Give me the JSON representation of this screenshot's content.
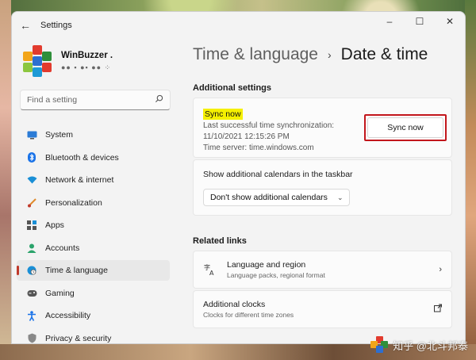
{
  "window": {
    "title": "Settings",
    "controls": {
      "minimize": "–",
      "maximize": "☐",
      "close": "✕"
    }
  },
  "profile": {
    "name": "WinBuzzer .",
    "sub": "●● ▪ ●▪ ●● ⁘"
  },
  "search": {
    "placeholder": "Find a setting",
    "icon": "search-icon"
  },
  "nav": {
    "items": [
      {
        "label": "System",
        "icon": "monitor-icon",
        "color": "#2b7bd6"
      },
      {
        "label": "Bluetooth & devices",
        "icon": "bluetooth-icon",
        "color": "#1a73e8"
      },
      {
        "label": "Network & internet",
        "icon": "wifi-icon",
        "color": "#1a8fd6"
      },
      {
        "label": "Personalization",
        "icon": "brush-icon",
        "color": "#e08a2b"
      },
      {
        "label": "Apps",
        "icon": "apps-icon",
        "color": "#555"
      },
      {
        "label": "Accounts",
        "icon": "person-icon",
        "color": "#2aa36b"
      },
      {
        "label": "Time & language",
        "icon": "globe-clock-icon",
        "color": "#1a8fd6",
        "active": true
      },
      {
        "label": "Gaming",
        "icon": "gamepad-icon",
        "color": "#555"
      },
      {
        "label": "Accessibility",
        "icon": "accessibility-icon",
        "color": "#1a73e8"
      },
      {
        "label": "Privacy & security",
        "icon": "shield-icon",
        "color": "#888"
      }
    ]
  },
  "main": {
    "breadcrumb": {
      "parent": "Time & language",
      "separator": "›",
      "current": "Date & time"
    },
    "additional_settings": {
      "title": "Additional settings",
      "sync": {
        "title": "Sync now",
        "last_sync_label": "Last successful time synchronization:",
        "last_sync_time": "11/10/2021 12:15:26 PM",
        "time_server": "Time server: time.windows.com",
        "button": "Sync now"
      },
      "calendars": {
        "label": "Show additional calendars in the taskbar",
        "selected": "Don't show additional calendars"
      }
    },
    "related_links": {
      "title": "Related links",
      "items": [
        {
          "title": "Language and region",
          "subtitle": "Language packs, regional format",
          "icon": "language-icon",
          "end_icon": "chevron-right-icon"
        },
        {
          "title": "Additional clocks",
          "subtitle": "Clocks for different time zones",
          "icon": "",
          "end_icon": "external-link-icon"
        }
      ]
    }
  },
  "watermark": {
    "text": "知乎 @北斗邦泰"
  },
  "colors": {
    "highlight": "#f5f000",
    "sync_outline": "#c2161c",
    "active_indicator": "#c0392b"
  }
}
